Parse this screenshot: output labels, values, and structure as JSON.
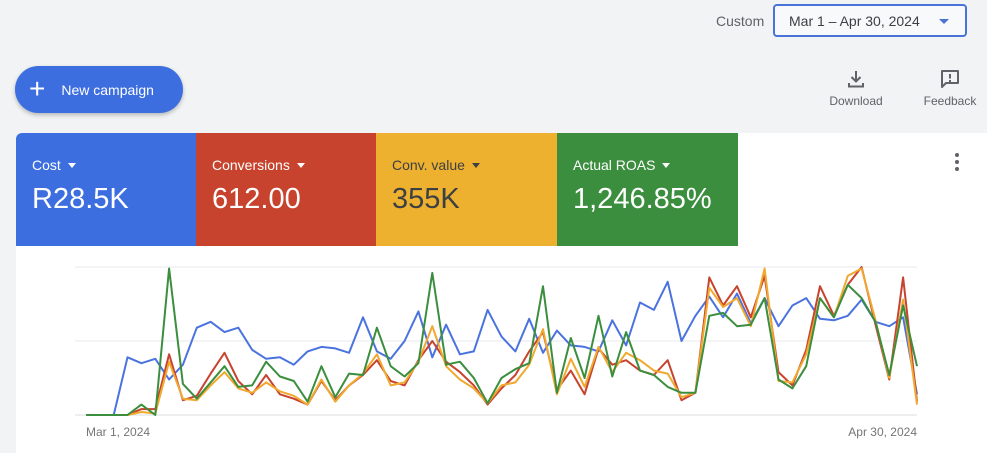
{
  "header": {
    "range_label": "Custom",
    "date_range": "Mar 1 – Apr 30, 2024",
    "new_campaign": "New campaign",
    "download": "Download",
    "feedback": "Feedback"
  },
  "metrics": [
    {
      "label": "Cost",
      "value": "R28.5K",
      "color": "#3c6ee0",
      "text_color": "#ffffff"
    },
    {
      "label": "Conversions",
      "value": "612.00",
      "color": "#c8432e",
      "text_color": "#ffffff"
    },
    {
      "label": "Conv. value",
      "value": "355K",
      "color": "#edb02f",
      "text_color": "#3c4043"
    },
    {
      "label": "Actual ROAS",
      "value": "1,246.85%",
      "color": "#3b8e3e",
      "text_color": "#ffffff"
    }
  ],
  "chart_data": {
    "type": "line",
    "x_tick_labels": [
      "Mar 1, 2024",
      "Apr 30, 2024"
    ],
    "x_start": "2024-03-01",
    "x_end": "2024-04-30",
    "ylim": [
      0,
      100
    ],
    "grid": true,
    "series": [
      {
        "name": "Cost",
        "color": "#4a73e0",
        "values": [
          0,
          0,
          0,
          39,
          35,
          38,
          24,
          34,
          59,
          63,
          56,
          59,
          44,
          38,
          39,
          34,
          43,
          46,
          45,
          42,
          66,
          43,
          38,
          50,
          70,
          39,
          61,
          41,
          43,
          71,
          53,
          43,
          65,
          42,
          57,
          47,
          46,
          43,
          64,
          47,
          76,
          71,
          90,
          50,
          67,
          80,
          66,
          82,
          62,
          79,
          60,
          74,
          79,
          65,
          64,
          67,
          78,
          63,
          60,
          66,
          14
        ]
      },
      {
        "name": "Conversions",
        "color": "#c8432e",
        "values": [
          0,
          0,
          0,
          0,
          4,
          4,
          41,
          10,
          13,
          28,
          42,
          23,
          14,
          27,
          14,
          11,
          7,
          23,
          10,
          20,
          27,
          37,
          23,
          20,
          37,
          50,
          36,
          29,
          20,
          7,
          18,
          27,
          43,
          56,
          17,
          30,
          14,
          45,
          34,
          37,
          30,
          27,
          37,
          10,
          15,
          93,
          74,
          87,
          66,
          94,
          29,
          20,
          44,
          87,
          67,
          88,
          100,
          61,
          24,
          93,
          9
        ]
      },
      {
        "name": "Conv. value",
        "color": "#f0a92e",
        "values": [
          0,
          0,
          0,
          0,
          2,
          1,
          36,
          11,
          10,
          20,
          29,
          18,
          15,
          22,
          16,
          13,
          7,
          24,
          9,
          20,
          28,
          41,
          20,
          22,
          36,
          60,
          33,
          24,
          18,
          8,
          20,
          22,
          34,
          58,
          14,
          38,
          19,
          46,
          29,
          42,
          37,
          30,
          28,
          12,
          15,
          86,
          73,
          79,
          60,
          99,
          23,
          22,
          41,
          79,
          66,
          94,
          99,
          64,
          25,
          78,
          7
        ]
      },
      {
        "name": "Actual ROAS",
        "color": "#3b8e3e",
        "values": [
          0,
          0,
          0,
          0,
          7,
          0,
          99,
          21,
          11,
          22,
          33,
          19,
          20,
          36,
          26,
          23,
          9,
          33,
          12,
          28,
          27,
          59,
          33,
          26,
          35,
          96,
          34,
          36,
          25,
          8,
          25,
          31,
          35,
          87,
          15,
          52,
          25,
          67,
          26,
          56,
          30,
          27,
          19,
          15,
          15,
          67,
          69,
          60,
          61,
          79,
          24,
          18,
          33,
          79,
          66,
          88,
          79,
          63,
          27,
          74,
          33
        ]
      }
    ]
  }
}
